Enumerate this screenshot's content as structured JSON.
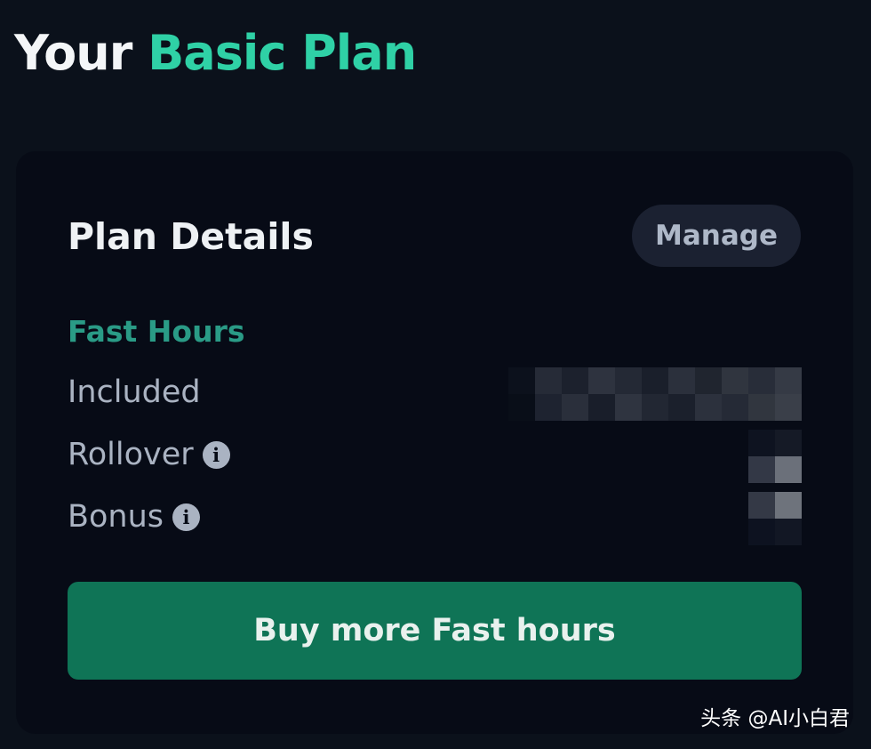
{
  "header": {
    "title_prefix": "Your",
    "title_accent": "Basic Plan"
  },
  "card": {
    "title": "Plan Details",
    "manage_label": "Manage",
    "section_label": "Fast Hours",
    "rows": [
      {
        "label": "Included",
        "value": "",
        "info": false
      },
      {
        "label": "Rollover",
        "value": "",
        "info": true
      },
      {
        "label": "Bonus",
        "value": "",
        "info": true
      }
    ],
    "buy_label": "Buy more Fast hours"
  },
  "icons": {
    "info": "info-circle-icon"
  },
  "watermark": "头条 @AI小白君",
  "colors": {
    "background": "#0b111b",
    "card": "#070b16",
    "accent": "#2fd1a6",
    "section_label": "#2a9b86",
    "button": "#0f7456",
    "manage_bg": "#1b2131"
  }
}
